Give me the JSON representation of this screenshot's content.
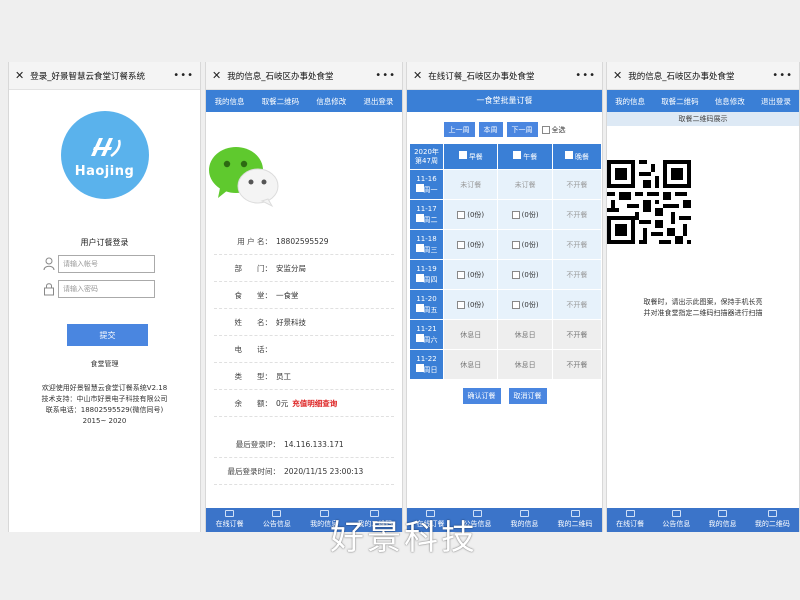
{
  "screens": [
    {
      "title": "登录_好景智慧云食堂订餐系统",
      "logo_text": "Haojing",
      "login_title": "用户订餐登录",
      "account_placeholder": "请输入帐号",
      "password_placeholder": "请输入密码",
      "submit_label": "提交",
      "admin_link": "食堂管理",
      "footer": [
        "欢迎使用好景智慧云食堂订餐系统V2.18",
        "技术支持：中山市好景电子科技有限公司",
        "联系电话：18802595529(微信同号)",
        "2015~ 2020"
      ]
    },
    {
      "title": "我的信息_石岐区办事处食堂",
      "nav": [
        "我的信息",
        "取餐二维码",
        "信息修改",
        "退出登录"
      ],
      "info": [
        {
          "label": "用 户 名：",
          "value": "18802595529"
        },
        {
          "label": "部　　门：",
          "value": "安监分局"
        },
        {
          "label": "食　　堂：",
          "value": "一食堂"
        },
        {
          "label": "姓　　名：",
          "value": "好景科技"
        },
        {
          "label": "电　　话：",
          "value": ""
        },
        {
          "label": "类　　型：",
          "value": "员工"
        },
        {
          "label": "余　　额：",
          "value": "0元",
          "link": "充值明细查询"
        }
      ],
      "last_ip_label": "最后登录IP：",
      "last_ip": "14.116.133.171",
      "last_time_label": "最后登录时间：",
      "last_time": "2020/11/15 23:00:13"
    },
    {
      "title": "在线订餐_石岐区办事处食堂",
      "header": "一食堂批量订餐",
      "buttons": [
        "上一周",
        "本周",
        "下一周"
      ],
      "select_all": "全选",
      "year_label": "2020年",
      "week_label": "第47周",
      "meals": [
        "早餐",
        "午餐",
        "晚餐"
      ],
      "rows": [
        {
          "date": "11-16",
          "day": "周一",
          "cells": [
            "未订餐",
            "未订餐",
            "不开餐"
          ],
          "rest": false
        },
        {
          "date": "11-17",
          "day": "周二",
          "cells": [
            "(0份)",
            "(0份)",
            "不开餐"
          ],
          "rest": false
        },
        {
          "date": "11-18",
          "day": "周三",
          "cells": [
            "(0份)",
            "(0份)",
            "不开餐"
          ],
          "rest": false
        },
        {
          "date": "11-19",
          "day": "周四",
          "cells": [
            "(0份)",
            "(0份)",
            "不开餐"
          ],
          "rest": false
        },
        {
          "date": "11-20",
          "day": "周五",
          "cells": [
            "(0份)",
            "(0份)",
            "不开餐"
          ],
          "rest": false
        },
        {
          "date": "11-21",
          "day": "周六",
          "cells": [
            "休息日",
            "休息日",
            "不开餐"
          ],
          "rest": true
        },
        {
          "date": "11-22",
          "day": "周日",
          "cells": [
            "休息日",
            "休息日",
            "不开餐"
          ],
          "rest": true
        }
      ],
      "confirm_label": "确认订餐",
      "cancel_label": "取消订餐"
    },
    {
      "title": "我的信息_石岐区办事处食堂",
      "nav": [
        "我的信息",
        "取餐二维码",
        "信息修改",
        "退出登录"
      ],
      "qr_bar": "取餐二维码展示",
      "hint": [
        "取餐时，请出示此图案，保持手机长亮",
        "并对准食堂指定二维码扫描器进行扫描"
      ]
    }
  ],
  "bottom_nav": [
    "在线订餐",
    "公告信息",
    "我的信息",
    "我的二维码"
  ],
  "colors": {
    "primary": "#3a7fd6",
    "cell_bg": "#e7f2fb",
    "alert": "#dd2222",
    "logo": "#5ab2ec"
  },
  "watermark": "好景科技"
}
